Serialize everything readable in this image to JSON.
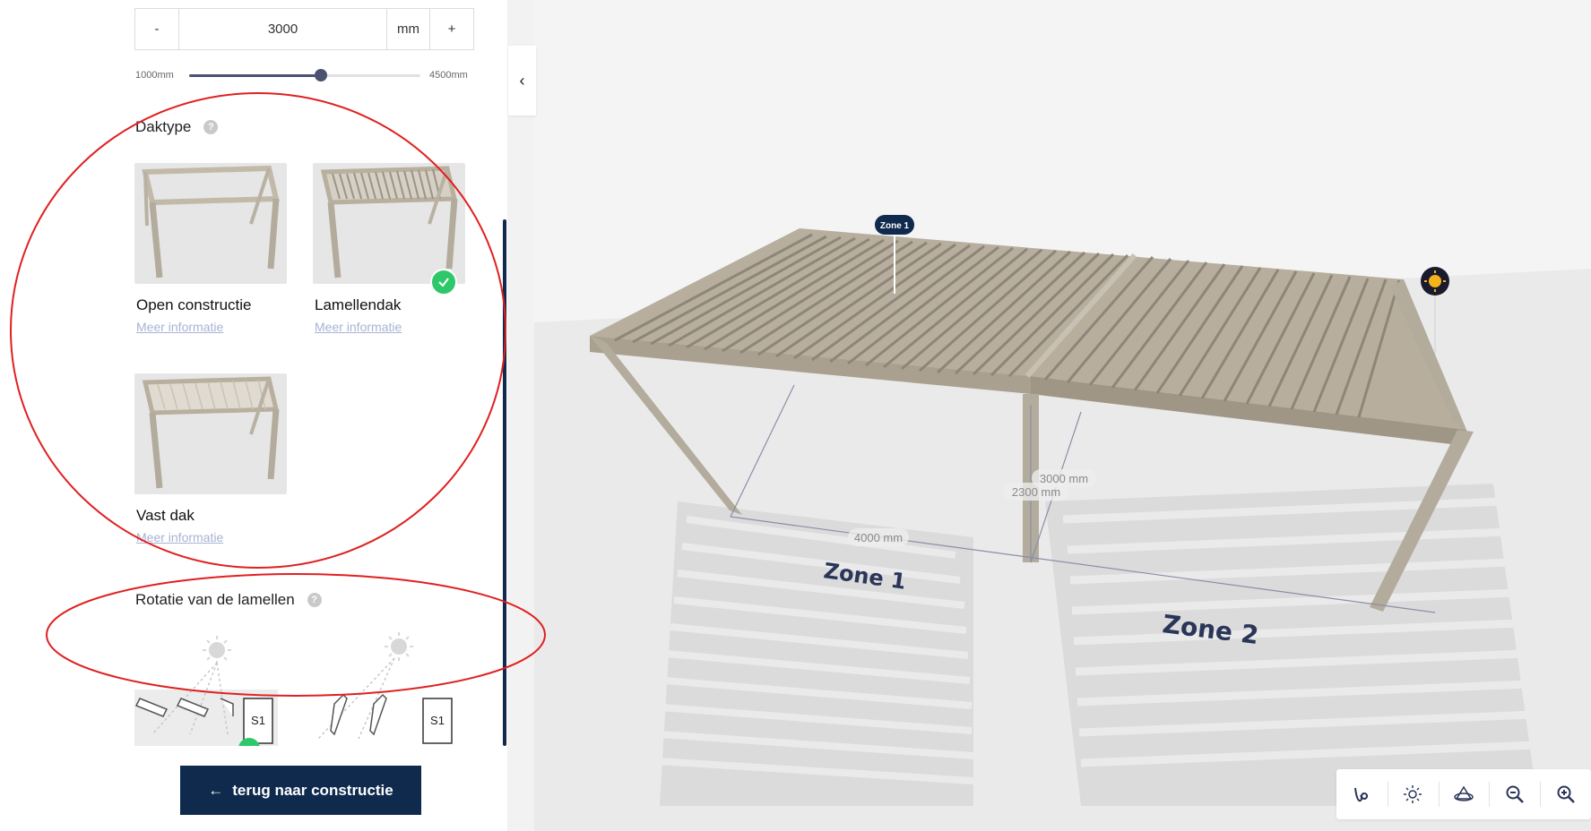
{
  "config": {
    "stepper": {
      "minus_label": "-",
      "value": "3000",
      "unit": "mm",
      "plus_label": "+"
    },
    "slider": {
      "min_label": "1000mm",
      "max_label": "4500mm",
      "min": 1000,
      "max": 4500,
      "value": 3000
    }
  },
  "roof_type": {
    "title": "Daktype",
    "help": "?",
    "options": [
      {
        "name": "Open constructie",
        "link": "Meer informatie",
        "selected": false
      },
      {
        "name": "Lamellendak",
        "link": "Meer informatie",
        "selected": true
      },
      {
        "name": "Vast dak",
        "link": "Meer informatie",
        "selected": false
      }
    ]
  },
  "rotation": {
    "title": "Rotatie van de lamellen",
    "help": "?",
    "options": [
      {
        "badge": "S1"
      },
      {
        "badge": "S1"
      }
    ]
  },
  "footer": {
    "back_arrow": "←",
    "back_label": "terug naar constructie"
  },
  "viewer": {
    "collapse_icon": "‹",
    "zone_pin_label": "Zone 1",
    "zone_labels": [
      "Zone 1",
      "Zone 2"
    ],
    "dimensions": {
      "width": "4000 mm",
      "depth": "3000 mm",
      "height": "2300 mm"
    },
    "toolbar": [
      "measure-icon",
      "sun-icon",
      "rotate-3d-icon",
      "zoom-out-icon",
      "zoom-in-icon"
    ]
  },
  "colors": {
    "primary": "#0f2a4d",
    "selected": "#2ec86a",
    "annotation": "#e02020",
    "frame": "#b3ab9c"
  }
}
